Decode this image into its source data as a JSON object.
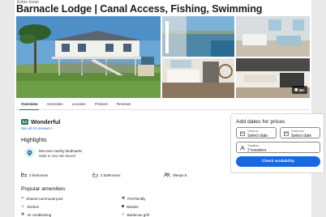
{
  "listing": {
    "property_type": "Entire home",
    "title": "Barnacle Lodge | Canal Access, Fishing, Swimming"
  },
  "gallery": {
    "more_count": "36+"
  },
  "tabs": [
    "Overview",
    "Amenities",
    "Location",
    "Policies",
    "Reviews"
  ],
  "active_tab": "Overview",
  "rating": {
    "score": "8.0",
    "label": "Wonderful",
    "reviews_link": "See all 10 reviews"
  },
  "highlights": {
    "heading": "Highlights",
    "item_title": "Discover nearby landmarks",
    "item_sub": "Walk to Sea Isle Beach"
  },
  "stats": {
    "bedrooms": "3 bedrooms",
    "bathrooms": "2 bathrooms",
    "sleeps": "Sleeps 8"
  },
  "amenities": {
    "heading": "Popular amenities",
    "items": [
      "Shared communal pool",
      "Pet-friendly",
      "Kitchen",
      "Washer",
      "Air conditioning",
      "Barbecue grill"
    ]
  },
  "booking": {
    "title": "Add dates for prices",
    "checkin_label": "Check-in",
    "checkin_value": "Select date",
    "checkout_label": "Check-out",
    "checkout_value": "Select date",
    "travelers_label": "Travelers",
    "travelers_value": "2 travelers",
    "button": "Check availability"
  },
  "colors": {
    "accent": "#1668e3",
    "rating_badge": "#227950"
  }
}
